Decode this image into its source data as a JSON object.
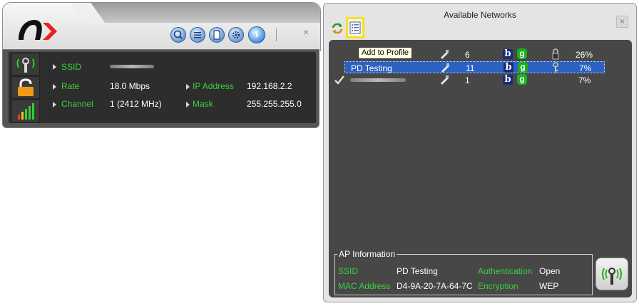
{
  "utility": {
    "labels": {
      "ssid": "SSID",
      "rate": "Rate",
      "channel": "Channel",
      "ip_address": "IP Address",
      "mask": "Mask"
    },
    "values": {
      "rate": "18.0 Mbps",
      "channel": "1 (2412 MHz)",
      "ip_address": "192.168.2.2",
      "mask": "255.255.255.0"
    },
    "toolbar_icons": [
      "search-icon",
      "list-icon",
      "page-icon",
      "settings-icon",
      "info-icon"
    ],
    "info_glyph": "i",
    "close_glyph": "×"
  },
  "networks_window": {
    "title": "Available Networks",
    "close_glyph": "×",
    "tooltip": "Add to Profile",
    "rows": [
      {
        "name": "",
        "channel": "6",
        "signal": "26%",
        "b": "b",
        "g": "g",
        "has_lock": true
      },
      {
        "name": "PD Testing",
        "channel": "11",
        "signal": "7%",
        "b": "b",
        "g": "g",
        "has_lock": true
      },
      {
        "name": "",
        "channel": "1",
        "signal": "7%",
        "b": "b",
        "g": "g",
        "has_lock": false
      }
    ],
    "ap_info": {
      "legend": "AP Information",
      "ssid_label": "SSID",
      "ssid_value": "PD Testing",
      "mac_label": "MAC Address",
      "mac_value": "D4-9A-20-7A-64-7C",
      "auth_label": "Authentication",
      "auth_value": "Open",
      "enc_label": "Encryption",
      "enc_value": "WEP"
    }
  },
  "colors": {
    "label_green": "#3ad23a",
    "selection_blue": "#2b61c0",
    "highlight_yellow": "#f6e21a",
    "logo_red": "#e8221c"
  }
}
